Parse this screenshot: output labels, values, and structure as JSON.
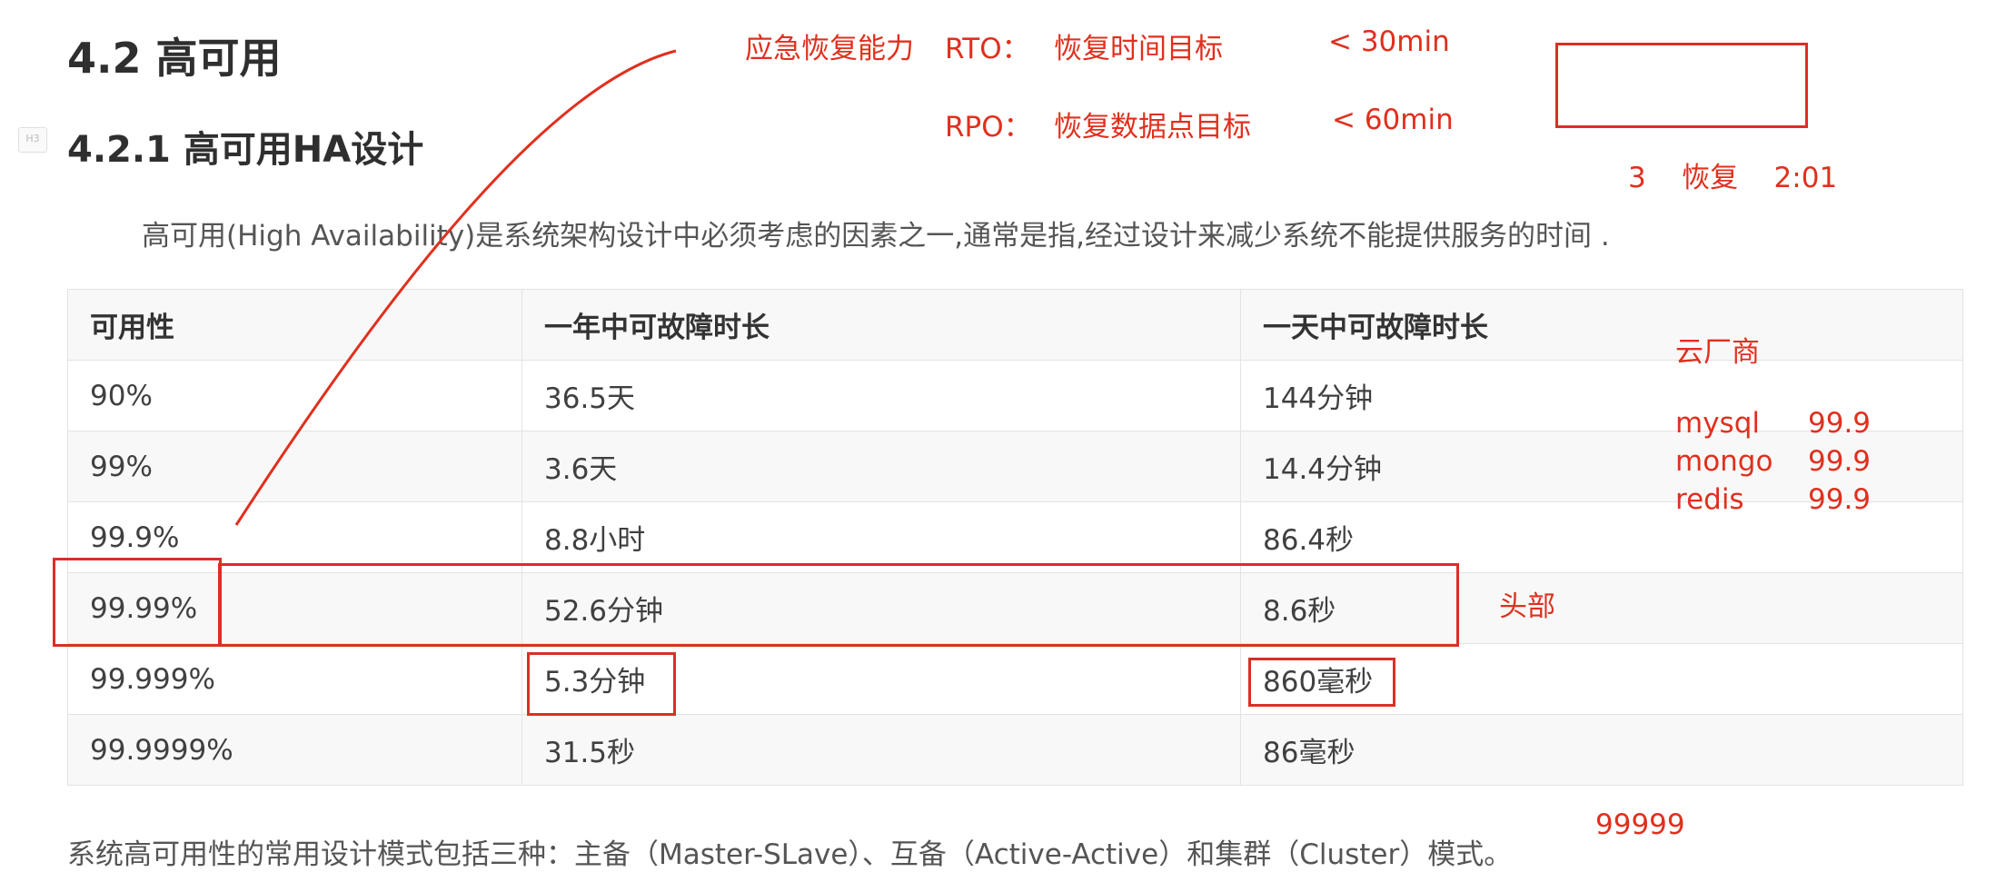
{
  "heading": {
    "section": "4.2 高可用",
    "subsection": "4.2.1 高可用HA设计"
  },
  "anchor_icon": "h3-anchor-icon",
  "intro": "高可用(High Availability)是系统架构设计中必须考虑的因素之一,通常是指,经过设计来减少系统不能提供服务的时间 .",
  "table": {
    "headers": [
      "可用性",
      "一年中可故障时长",
      "一天中可故障时长"
    ],
    "rows": [
      [
        "90%",
        "36.5天",
        "144分钟"
      ],
      [
        "99%",
        "3.6天",
        "14.4分钟"
      ],
      [
        "99.9%",
        "8.8小时",
        "86.4秒"
      ],
      [
        "99.99%",
        "52.6分钟",
        "8.6秒"
      ],
      [
        "99.999%",
        "5.3分钟",
        "860毫秒"
      ],
      [
        "99.9999%",
        "31.5秒",
        "86毫秒"
      ]
    ]
  },
  "outro": "系统高可用性的常用设计模式包括三种：主备（Master-SLave）、互备（Active-Active）和集群（Cluster）模式。",
  "annotations": {
    "emergency": "应急恢复能力",
    "rto_label": "RTO：",
    "rto_desc": "恢复时间目标",
    "rto_value": "< 30min",
    "rpo_label": "RPO：",
    "rpo_desc": "恢复数据点目标",
    "rpo_value": "< 60min",
    "recovery_note": "3    恢复    2:01",
    "cloud_vendor": "云厂商",
    "services": [
      {
        "name": "mysql",
        "value": "99.9"
      },
      {
        "name": "mongo",
        "value": "99.9"
      },
      {
        "name": "redis",
        "value": "99.9"
      }
    ],
    "head_tier": "头部",
    "nines": "99999"
  },
  "colors": {
    "annotation": "#e0301e",
    "text": "#333333",
    "table_stripe": "#f8f8f8"
  }
}
